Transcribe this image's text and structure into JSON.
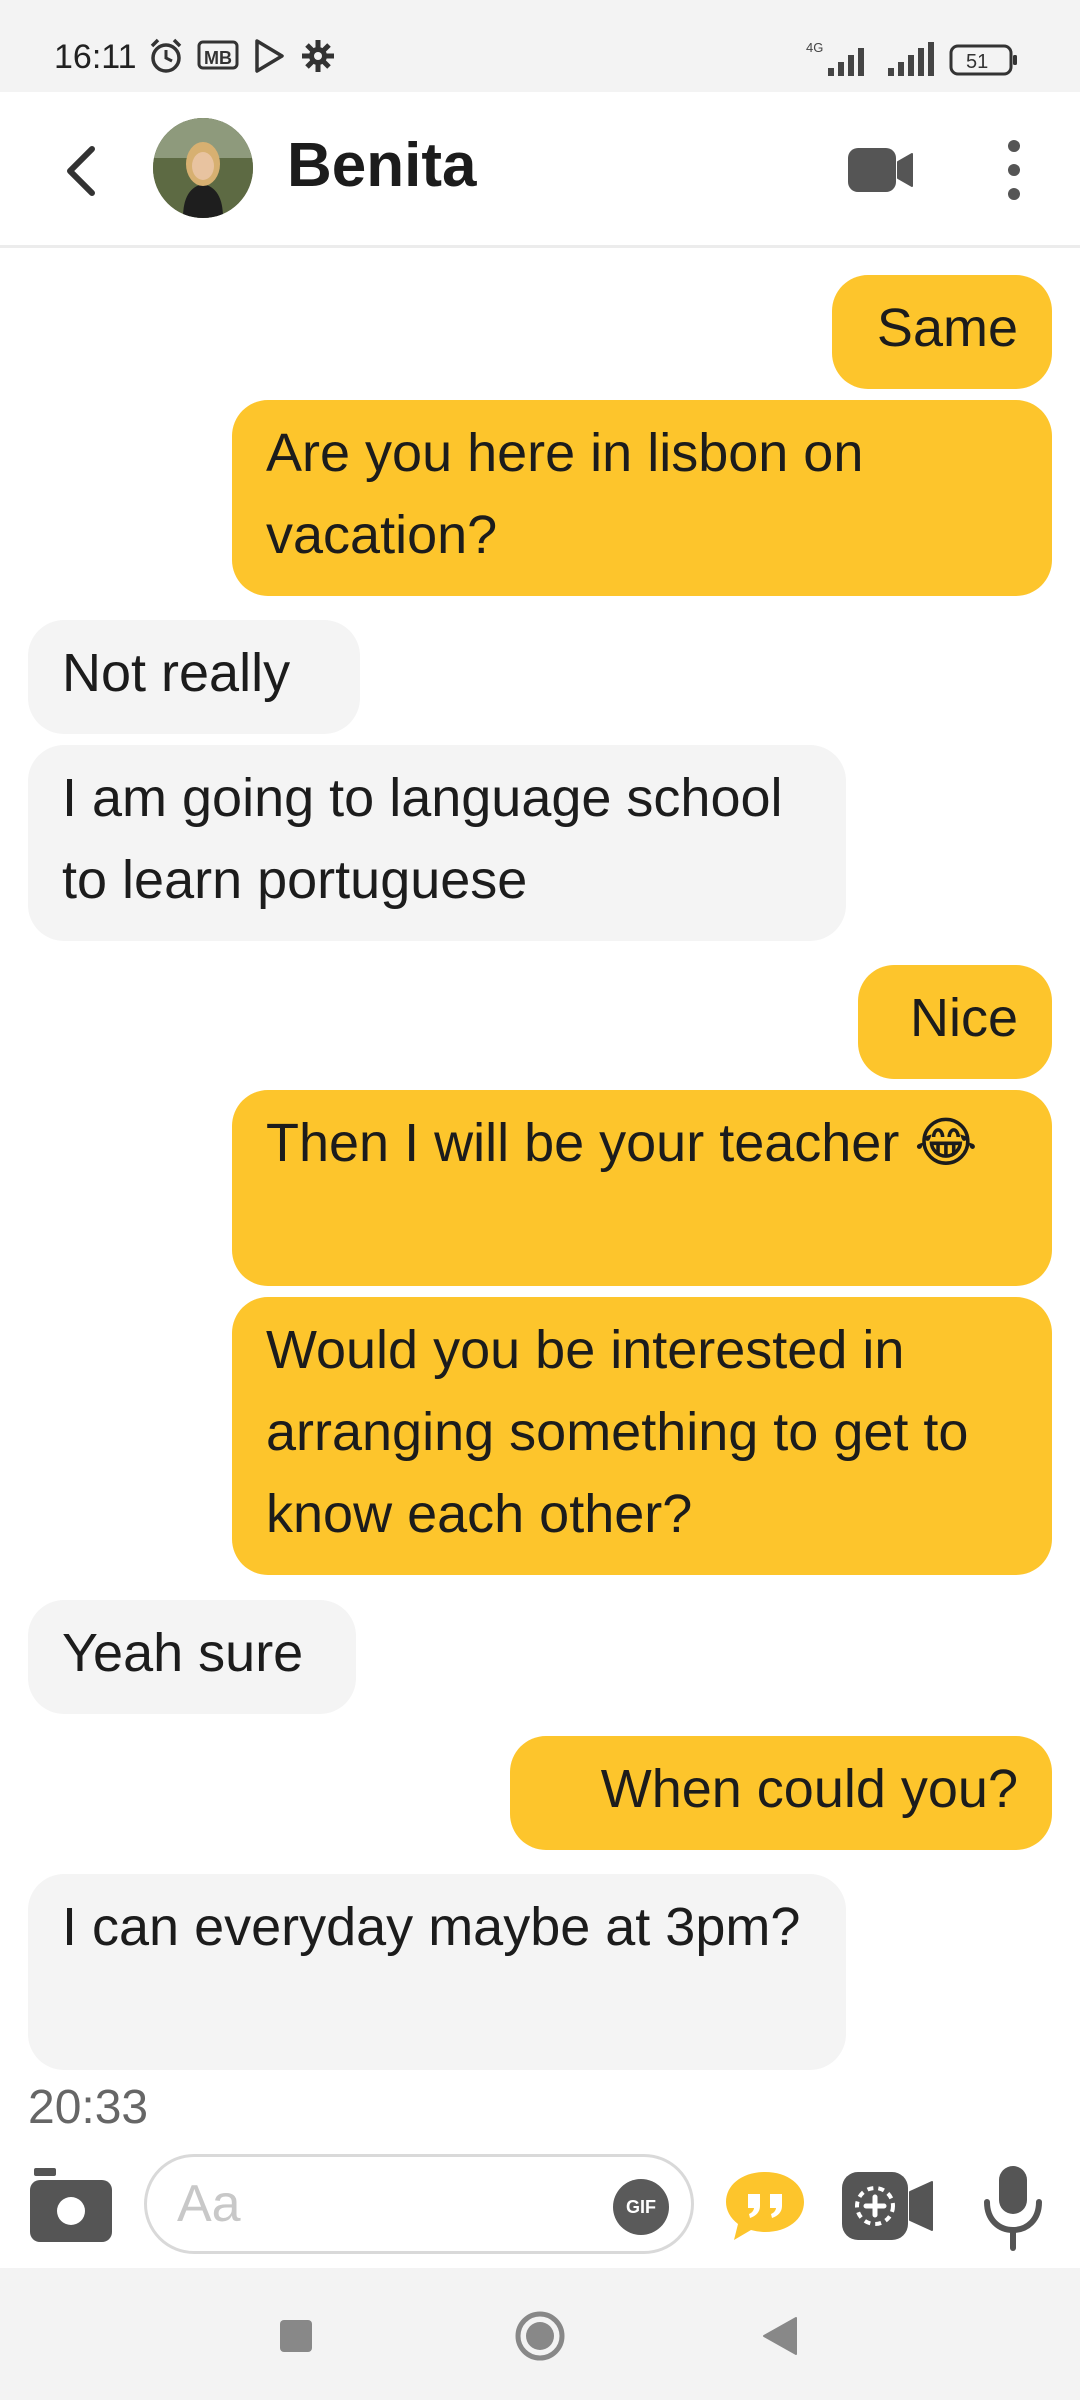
{
  "status_bar": {
    "time": "16:11",
    "network": "4G",
    "battery": "51"
  },
  "header": {
    "contact_name": "Benita",
    "back_icon": "chevron-left-icon",
    "video_icon": "video-camera-icon",
    "more_icon": "more-vertical-icon"
  },
  "messages": [
    {
      "direction": "out",
      "text": "Same"
    },
    {
      "direction": "out",
      "text": "Are you here in lisbon on vacation?"
    },
    {
      "direction": "in",
      "text": "Not really"
    },
    {
      "direction": "in",
      "text": "I am going to language school to learn portuguese"
    },
    {
      "direction": "out",
      "text": "Nice"
    },
    {
      "direction": "out",
      "text": "Then I will be your teacher 😂"
    },
    {
      "direction": "out",
      "text": "Would you be interested in arranging something to get to know each other?"
    },
    {
      "direction": "in",
      "text": "Yeah sure"
    },
    {
      "direction": "out",
      "text": "When could you?"
    },
    {
      "direction": "in",
      "text": "I can everyday maybe at 3pm?"
    }
  ],
  "timestamp": "20:33",
  "composer": {
    "placeholder": "Aa",
    "gif_label": "GIF"
  },
  "colors": {
    "outgoing_bubble": "#fdc52c",
    "incoming_bubble": "#f4f4f4"
  }
}
